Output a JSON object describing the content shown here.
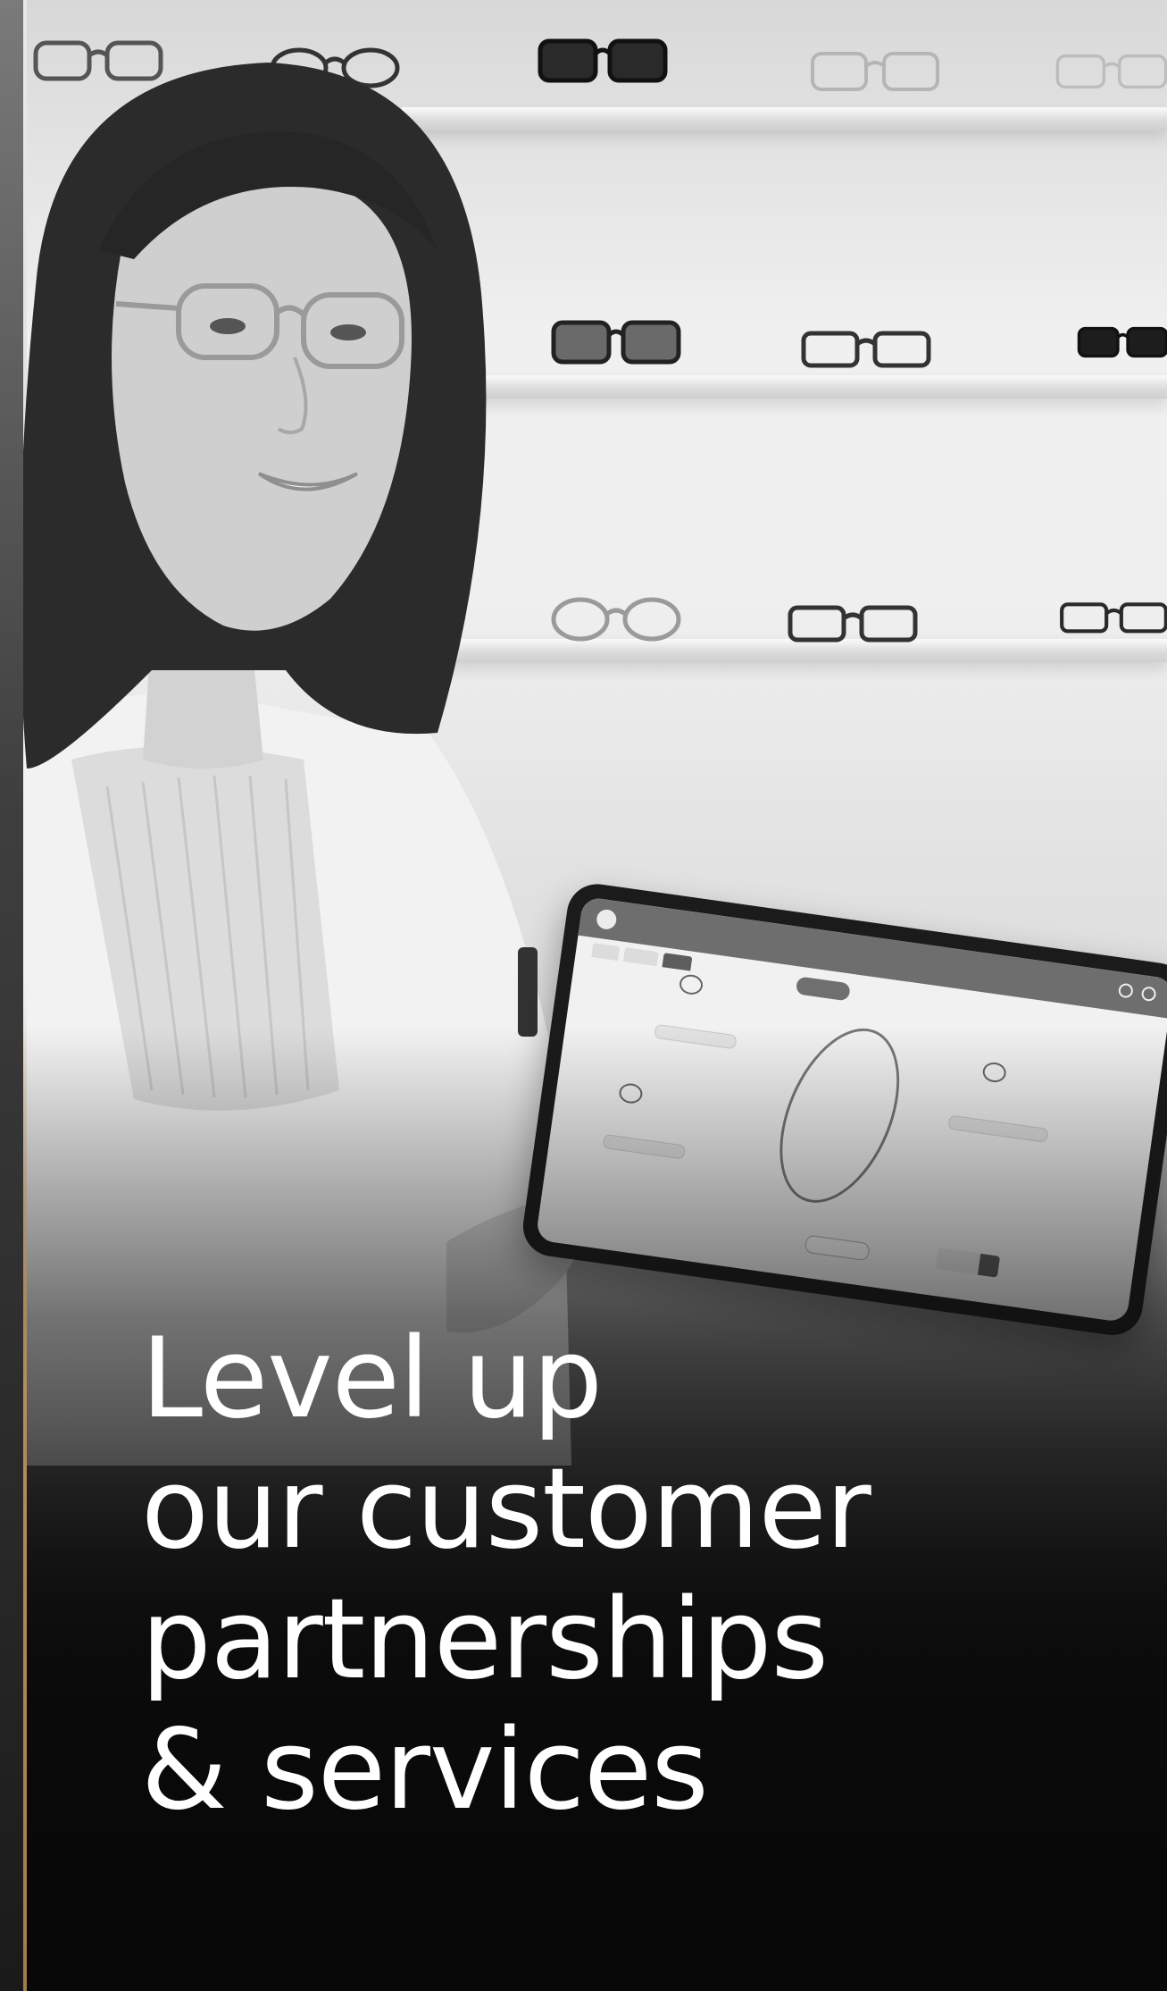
{
  "headline": {
    "line1": "Level up",
    "line2": "our customer",
    "line3": "partnerships",
    "line4": "& services"
  },
  "colors": {
    "headline_text": "#ffffff",
    "accent_line": "#b48e5a",
    "background_bottom": "#080808"
  },
  "image": {
    "style": "black-and-white photo"
  }
}
